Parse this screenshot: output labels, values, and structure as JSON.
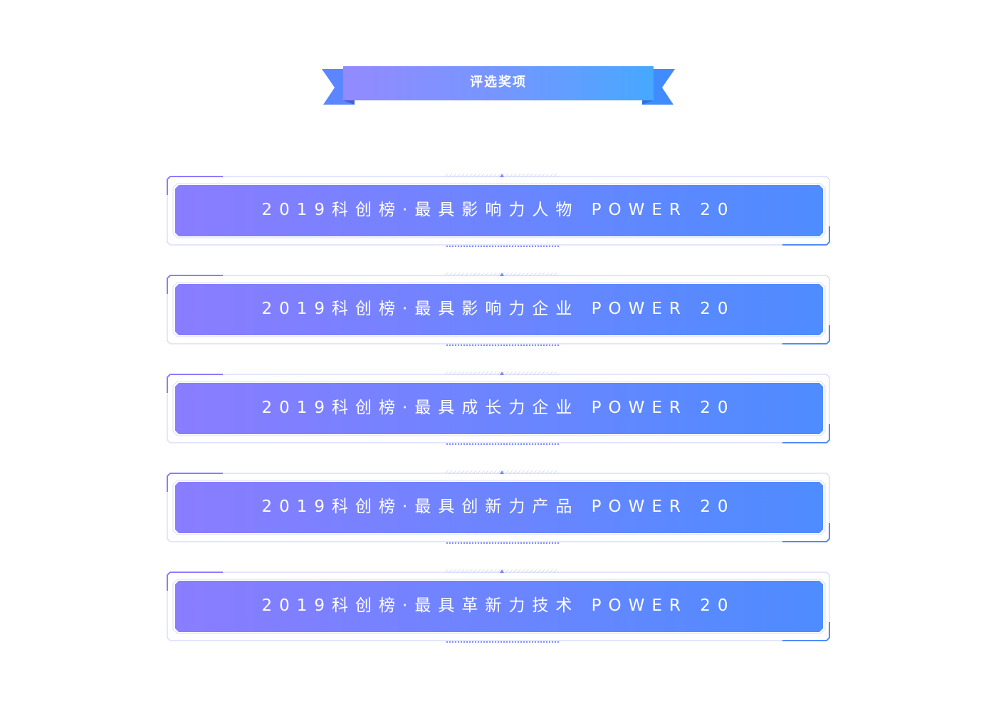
{
  "header": {
    "title": "评选奖项"
  },
  "awards": [
    {
      "label": "2019科创榜·最具影响力人物 POWER 20"
    },
    {
      "label": "2019科创榜·最具影响力企业 POWER 20"
    },
    {
      "label": "2019科创榜·最具成长力企业 POWER 20"
    },
    {
      "label": "2019科创榜·最具创新力产品 POWER 20"
    },
    {
      "label": "2019科创榜·最具革新力技术 POWER 20"
    }
  ],
  "colors": {
    "gradient_start": "#8a7dff",
    "gradient_end": "#4d8dff",
    "ribbon_start": "#8e86ff",
    "ribbon_end": "#47a8ff",
    "ribbon_tail": "#4a8cff",
    "frame_line": "#a9b4ff"
  }
}
